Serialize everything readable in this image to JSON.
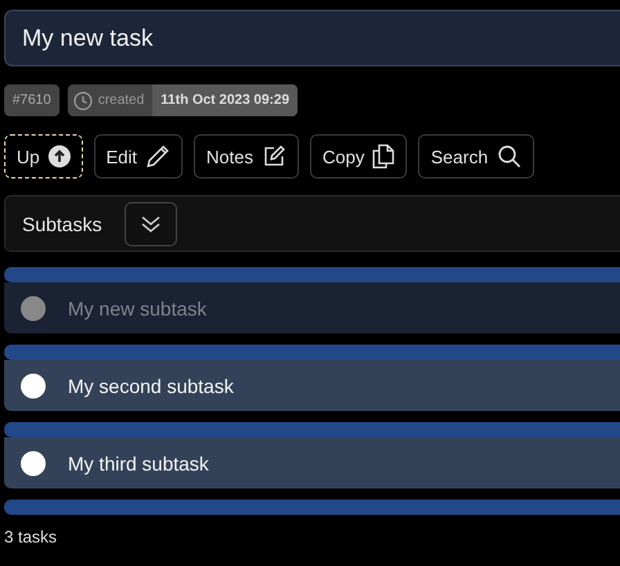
{
  "task": {
    "title": "My new task"
  },
  "meta": {
    "id": "#7610",
    "created_label": "created",
    "created_value": "11th Oct 2023 09:29"
  },
  "actions": [
    {
      "label": "Up",
      "kind": "up",
      "focused": true
    },
    {
      "label": "Edit",
      "kind": "edit",
      "focused": false
    },
    {
      "label": "Notes",
      "kind": "notes",
      "focused": false
    },
    {
      "label": "Copy",
      "kind": "copy",
      "focused": false
    },
    {
      "label": "Search",
      "kind": "search",
      "focused": false
    }
  ],
  "subtasks": {
    "title": "Subtasks",
    "items": [
      {
        "title": "My new subtask",
        "done": true
      },
      {
        "title": "My second subtask",
        "done": false
      },
      {
        "title": "My third subtask",
        "done": false
      }
    ]
  },
  "footer": "3 tasks"
}
